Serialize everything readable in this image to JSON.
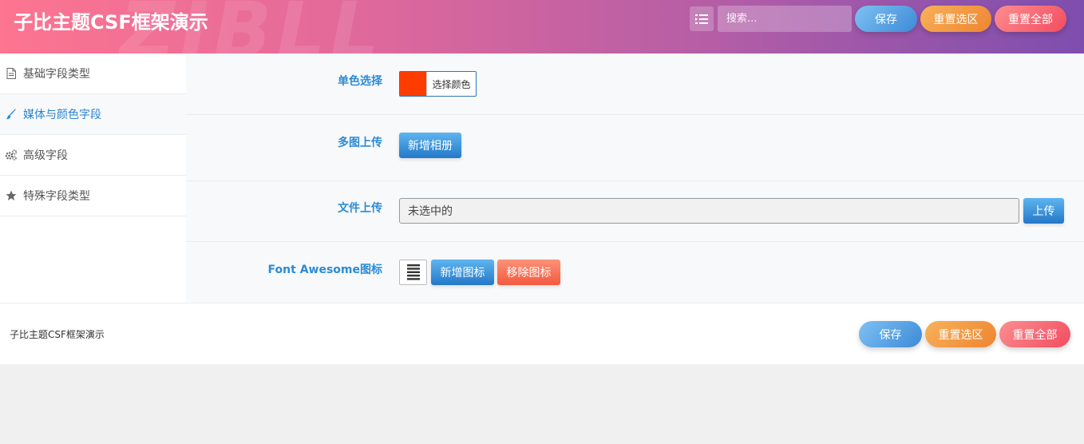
{
  "header": {
    "title": "子比主题CSF框架演示",
    "watermark": "ZIBLL",
    "toggle_icon": "list-icon",
    "search_placeholder": "搜索...",
    "save_label": "保存",
    "reset_section_label": "重置选区",
    "reset_all_label": "重置全部"
  },
  "sidebar": {
    "items": [
      {
        "label": "基础字段类型",
        "icon": "file-icon",
        "active": false
      },
      {
        "label": "媒体与颜色字段",
        "icon": "paint-brush-icon",
        "active": true
      },
      {
        "label": "高级字段",
        "icon": "cogs-icon",
        "active": false
      },
      {
        "label": "特殊字段类型",
        "icon": "star-icon",
        "active": false
      }
    ]
  },
  "fields": {
    "color": {
      "label": "单色选择",
      "value": "#ff3c00",
      "button_label": "选择颜色"
    },
    "gallery": {
      "label": "多图上传",
      "button_label": "新增相册"
    },
    "file": {
      "label": "文件上传",
      "value": "未选中的",
      "button_label": "上传"
    },
    "icon": {
      "label": "Font Awesome图标",
      "preview_icon": "align-justify-icon",
      "add_label": "新增图标",
      "remove_label": "移除图标"
    }
  },
  "footer": {
    "title": "子比主题CSF框架演示",
    "save_label": "保存",
    "reset_section_label": "重置选区",
    "reset_all_label": "重置全部"
  },
  "colors": {
    "accent_blue": "#2c8bd6",
    "swatch": "#ff3c00",
    "header_start": "#fd7590",
    "header_end": "#7e4eae"
  }
}
